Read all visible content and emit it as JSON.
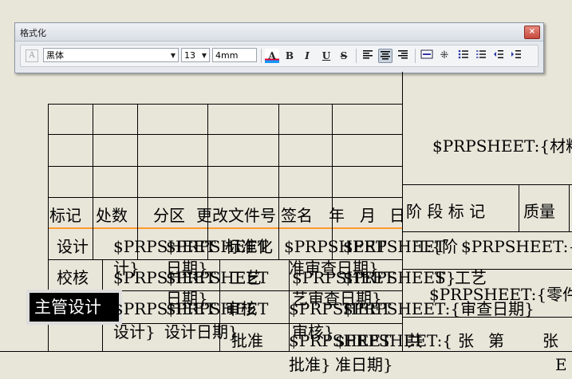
{
  "toolbar": {
    "title": "格式化",
    "close": "×",
    "font_name": "黑体",
    "font_size": "13",
    "char_height": "4mm",
    "icons": [
      "style-icon",
      "font-color-icon",
      "bold-icon",
      "italic-icon",
      "underline-icon",
      "strikethrough-icon",
      "align-left-icon",
      "align-center-icon",
      "align-right-icon",
      "insert-frame-icon",
      "grid-icon",
      "numbered-list-icon",
      "bulleted-list-icon",
      "outdent-icon",
      "indent-icon"
    ],
    "bold": "B",
    "italic": "I",
    "underline": "U",
    "strike": "S",
    "style_glyph": "A",
    "color_glyph": "A"
  },
  "drawing": {
    "header_right": "$PRPSHEET:{材料",
    "row_labels": {
      "mark": "标记",
      "count": "处数",
      "zone": "分区",
      "change_doc": "更改文件号",
      "sign": "签名",
      "year": "年",
      "month": "月",
      "day": "日"
    },
    "stage_header": {
      "stage": "阶 段 标 记",
      "weight": "质量"
    },
    "left_col": [
      "设计",
      "校核",
      "主管设计",
      ""
    ],
    "overlap_texts": {
      "r1a": "$PRPSHEET",
      "r1b": "$PRPSHEET",
      "r1c": "标准化",
      "r1d": "$PRPSHEET",
      "r1e": "$PRPSHEET",
      "r1f": "T:{阶",
      "r1g": "$PRPSHEET:{阶",
      "r1h": "计}",
      "r1i": "日期}",
      "r1j": "准审查日期}",
      "r2a": "$PRPSHEET",
      "r2b": "$PRPSHEET",
      "r2c": "工艺",
      "r2d": "$PRPSHEET",
      "r2e": "$PRPSHEET",
      "r2f": "S}",
      "r2g": "工艺",
      "r2h": "日期}",
      "r2i": "艺审查日期}",
      "r2j": "$PRPSHEET:{零件",
      "r3a": "$PRPSHEET",
      "r3b": "$PRPSHEET",
      "r3c": "审核",
      "r3d": "$PRPSHEET",
      "r3e": "$PRPSHEET:{审查日期}",
      "r3f": "设计}",
      "r3g": "设计日期}",
      "r3h": "审核}",
      "r4a": "批准",
      "r4b": "$PRPSHEET",
      "r4c": "$PRPSHEET:{",
      "r4d": "共",
      "r4e": "张",
      "r4f": "第",
      "r4g": "张",
      "r4h": "批准}",
      "r4i": "准日期}",
      "r4j": "E"
    }
  }
}
